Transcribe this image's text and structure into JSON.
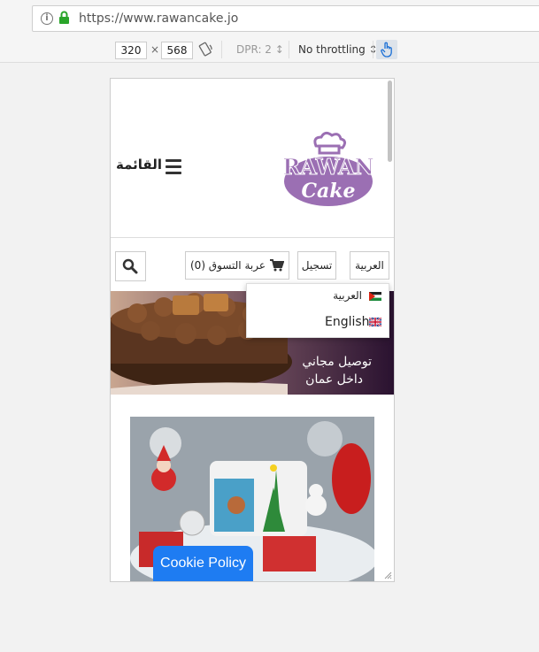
{
  "browser": {
    "url": "https://www.rawancake.jo",
    "device_width": "320",
    "device_height": "568",
    "dim_separator": "×",
    "dpr": "DPR: 2 ↕",
    "throttling": "No throttling ↕"
  },
  "site": {
    "logo_line1": "RAWAN",
    "logo_line2": "Cake",
    "menu_label": "القائمة",
    "nav": {
      "language_button": "العربية",
      "signup_button": "تسجيل",
      "cart_label": "عربة التسوق (0)"
    },
    "language_dropdown": {
      "arabic": "العربية",
      "english": "English"
    },
    "banner": {
      "line1": "توصيل مجاني",
      "line2": "داخل عمان"
    },
    "cookie_button": "Cookie Policy"
  },
  "colors": {
    "brand_purple": "#9b6fb3",
    "cookie_blue": "#1e7cf2"
  }
}
